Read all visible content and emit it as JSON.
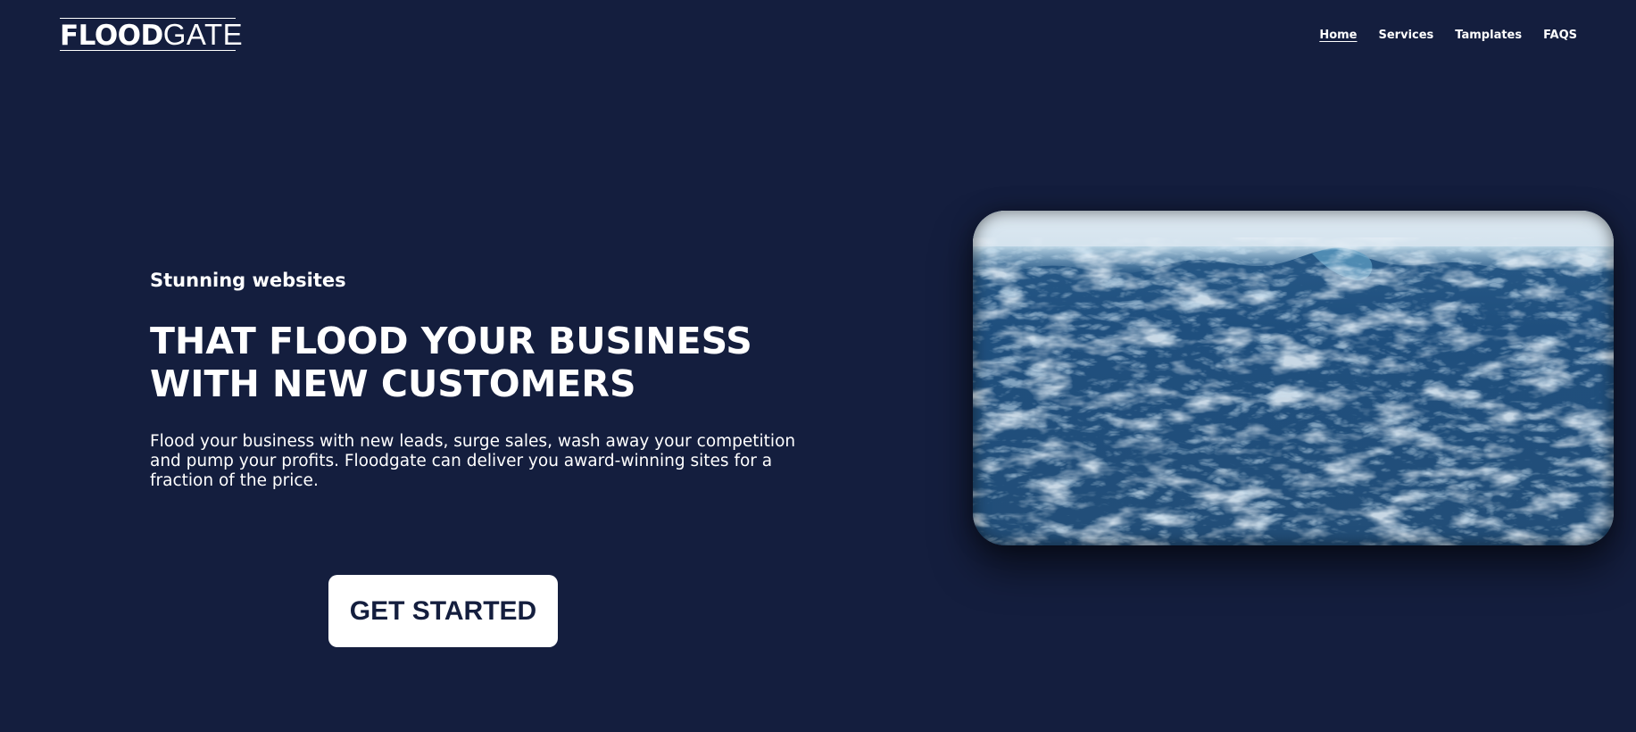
{
  "header": {
    "logo": {
      "bold_part": "FLOOD",
      "light_part": "GATE"
    },
    "nav": {
      "home": "Home",
      "services": "Services",
      "templates": "Tamplates",
      "faqs": "FAQS"
    }
  },
  "hero": {
    "eyebrow": "Stunning websites",
    "headline_line1": "THAT FLOOD YOUR BUSINESS",
    "headline_line2": "WITH NEW CUSTOMERS",
    "description": "Flood your business with new leads, surge sales, wash away your competition and pump your profits. Floodgate can deliver you award-winning sites for a fraction of the price.",
    "cta_label": "GET STARTED",
    "image_icon": "ocean-waves-image"
  },
  "colors": {
    "background": "#141e3e",
    "text": "#ffffff",
    "button_bg": "#ffffff",
    "button_text": "#141e3e",
    "water_deep": "#1f4f7e",
    "water_foam": "#c9dfec"
  }
}
